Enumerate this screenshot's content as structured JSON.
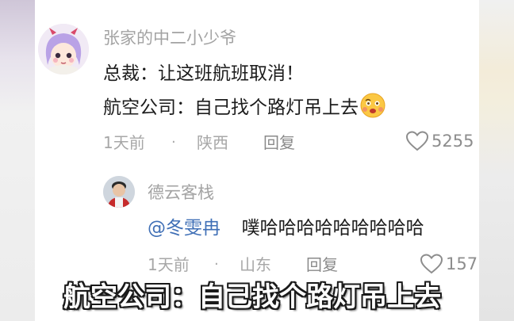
{
  "comment": {
    "username": "张家的中二小少爷",
    "lines": [
      "总裁：让这班航班取消！",
      "航空公司：自己找个路灯吊上去"
    ],
    "emoji": "dizzy-face-emoji",
    "time": "1天前",
    "separator": "·",
    "location": "陕西",
    "reply_label": "回复",
    "like_count": "5255"
  },
  "reply": {
    "username": "德云客栈",
    "mention": "@冬雯冉",
    "text": "噗哈哈哈哈哈哈哈哈哈",
    "time": "1天前",
    "separator": "·",
    "location": "山东",
    "reply_label": "回复",
    "like_count": "157"
  },
  "video_subtitle": "航空公司：自己找个路灯吊上去",
  "colors": {
    "username": "#a3a3a3",
    "content": "#1c1c1c",
    "meta": "#a7a7a7",
    "mention": "#3f6fb6",
    "subtitle_fill": "#ffffff",
    "subtitle_outline": "#1a1a1a"
  }
}
